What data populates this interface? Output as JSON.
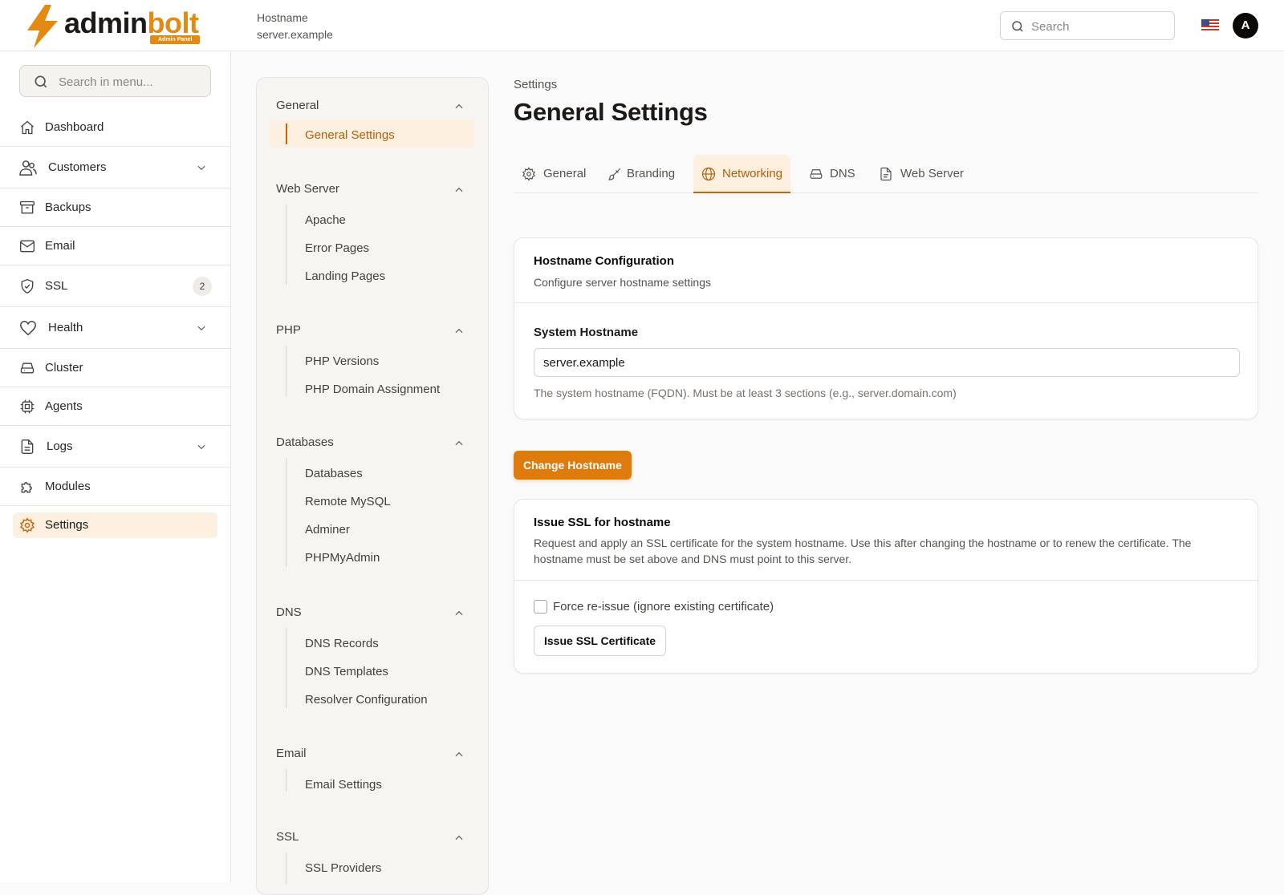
{
  "brand": {
    "name_part1": "admin",
    "name_part2": "bolt",
    "tagline": "Admin Panel"
  },
  "header": {
    "hostname_label": "Hostname",
    "hostname_value": "server.example",
    "search_placeholder": "Search",
    "avatar_initial": "A",
    "flag_icon": "us-flag-icon"
  },
  "sidebar": {
    "search_placeholder": "Search in menu...",
    "items": [
      {
        "label": "Dashboard",
        "icon": "home-icon"
      },
      {
        "label": "Customers",
        "icon": "users-icon",
        "expandable": true
      },
      {
        "label": "Backups",
        "icon": "archive-icon"
      },
      {
        "label": "Email",
        "icon": "mail-icon"
      },
      {
        "label": "SSL",
        "icon": "shield-check-icon",
        "badge": "2"
      },
      {
        "label": "Health",
        "icon": "heart-icon",
        "expandable": true
      },
      {
        "label": "Cluster",
        "icon": "hard-drive-icon"
      },
      {
        "label": "Agents",
        "icon": "cpu-icon"
      },
      {
        "label": "Logs",
        "icon": "file-text-icon",
        "expandable": true
      },
      {
        "label": "Modules",
        "icon": "puzzle-icon"
      },
      {
        "label": "Settings",
        "icon": "gear-icon",
        "active": true
      }
    ]
  },
  "settings_nav": {
    "groups": [
      {
        "title": "General",
        "links": [
          "General Settings"
        ],
        "active": "General Settings"
      },
      {
        "title": "Web Server",
        "links": [
          "Apache",
          "Error Pages",
          "Landing Pages"
        ]
      },
      {
        "title": "PHP",
        "links": [
          "PHP Versions",
          "PHP Domain Assignment"
        ]
      },
      {
        "title": "Databases",
        "links": [
          "Databases",
          "Remote MySQL",
          "Adminer",
          "PHPMyAdmin"
        ]
      },
      {
        "title": "DNS",
        "links": [
          "DNS Records",
          "DNS Templates",
          "Resolver Configuration"
        ]
      },
      {
        "title": "Email",
        "links": [
          "Email Settings"
        ]
      },
      {
        "title": "SSL",
        "links": [
          "SSL Providers"
        ]
      }
    ]
  },
  "main": {
    "breadcrumb": "Settings",
    "title": "General Settings",
    "tabs": [
      {
        "label": "General",
        "icon": "gear-icon"
      },
      {
        "label": "Branding",
        "icon": "brush-icon"
      },
      {
        "label": "Networking",
        "icon": "globe-icon",
        "active": true
      },
      {
        "label": "DNS",
        "icon": "hard-drive-icon"
      },
      {
        "label": "Web Server",
        "icon": "file-icon"
      }
    ],
    "hostname_card": {
      "title": "Hostname Configuration",
      "description": "Configure server hostname settings",
      "field_label": "System Hostname",
      "field_value": "server.example",
      "hint": "The system hostname (FQDN). Must be at least 3 sections (e.g., server.domain.com)"
    },
    "change_button": "Change Hostname",
    "ssl_card": {
      "title": "Issue SSL for hostname",
      "description": "Request and apply an SSL certificate for the system hostname. Use this after changing the hostname or to renew the certificate. The hostname must be set above and DNS must point to this server.",
      "checkbox_label": "Force re-issue (ignore existing certificate)",
      "checkbox_checked": false,
      "button": "Issue SSL Certificate"
    }
  },
  "colors": {
    "accent": "#df7a0c",
    "accent_soft": "#fdf0e0",
    "accent_text": "#b45f08"
  }
}
